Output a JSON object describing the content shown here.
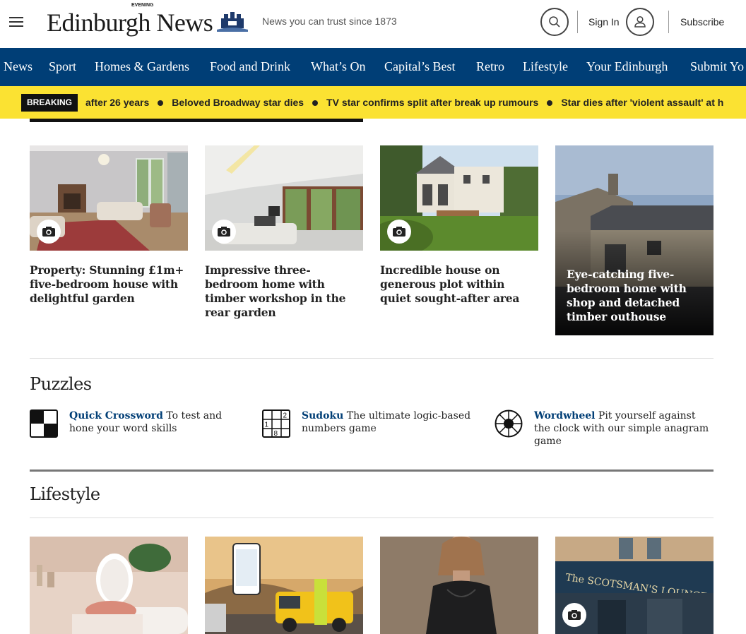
{
  "header": {
    "logo_text": "Edinburgh News",
    "logo_evening": "EVENING",
    "tagline": "News you can trust since 1873",
    "signin_label": "Sign In",
    "subscribe_label": "Subscribe"
  },
  "nav": {
    "items": [
      "News",
      "Sport",
      "Homes & Gardens",
      "Food and Drink",
      "What’s On",
      "Capital’s Best",
      "Retro",
      "Lifestyle",
      "Your Edinburgh",
      "Submit Yo"
    ]
  },
  "breaking": {
    "badge": "BREAKING",
    "items": [
      "after 26 years",
      "Beloved Broadway star dies",
      "TV star confirms split after break up rumours",
      "Star dies after 'violent assault' at h"
    ]
  },
  "property_articles": [
    {
      "headline": "Property: Stunning £1m+ five-bedroom house with delightful garden",
      "has_gallery": true
    },
    {
      "headline": "Impressive three-bedroom home with timber workshop in the rear garden",
      "has_gallery": true
    },
    {
      "headline": "Incredible house on generous plot within quiet sought-after area",
      "has_gallery": true
    },
    {
      "headline": "Eye-catching five-bedroom home with shop and detached timber outhouse",
      "has_gallery": false
    }
  ],
  "puzzles": {
    "title": "Puzzles",
    "items": [
      {
        "name": "Quick Crossword",
        "desc": "To test and hone your word skills",
        "icon": "crossword-icon"
      },
      {
        "name": "Sudoku",
        "desc": "The ultimate logic-based numbers game",
        "icon": "sudoku-icon",
        "icon_digits": [
          "2",
          "1",
          "8"
        ]
      },
      {
        "name": "Wordwheel",
        "desc": "Pit yourself against the clock with our simple anagram game",
        "icon": "wordwheel-icon"
      }
    ]
  },
  "lifestyle": {
    "title": "Lifestyle",
    "sign_text": "The SCOTSMAN'S LOUNGE"
  },
  "colors": {
    "brand_blue": "#003e76",
    "breaking_yellow": "#fbe232"
  }
}
